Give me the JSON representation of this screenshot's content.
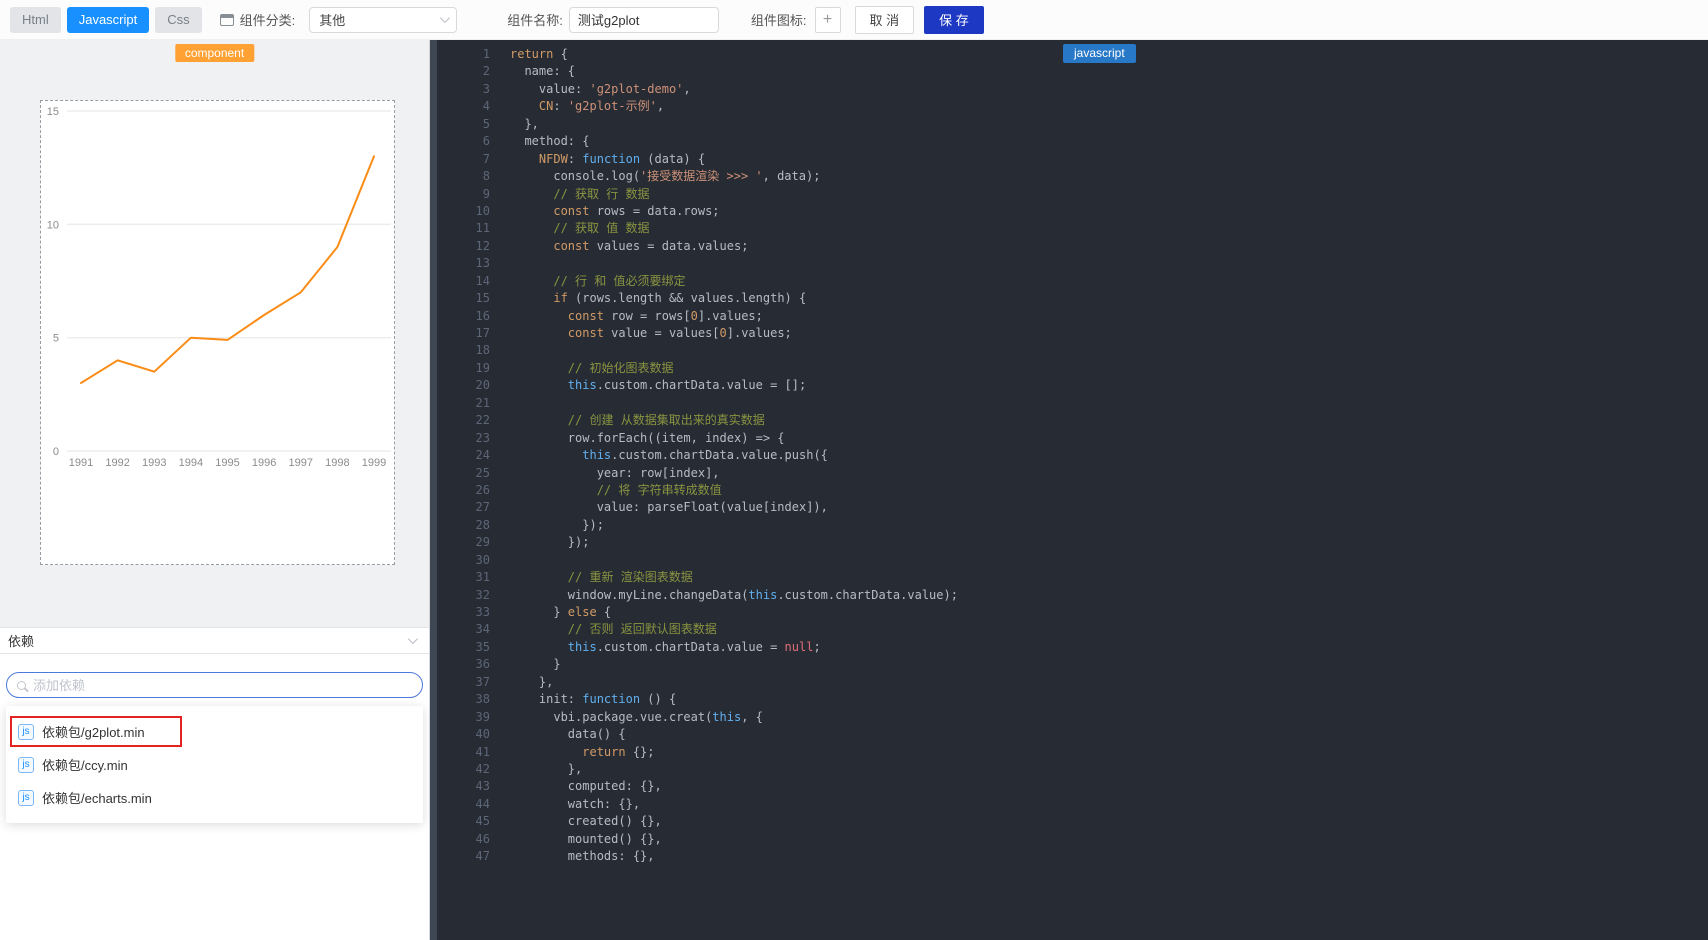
{
  "toolbar": {
    "tabs": [
      {
        "label": "Html"
      },
      {
        "label": "Javascript"
      },
      {
        "label": "Css"
      }
    ],
    "active_tab": "Javascript",
    "category_label": "组件分类:",
    "category_value": "其他",
    "name_label": "组件名称:",
    "name_value": "测试g2plot",
    "icon_label": "组件图标:",
    "add_icon_label": "+",
    "cancel_label": "取 消",
    "save_label": "保 存"
  },
  "left_panel": {
    "component_badge": "component",
    "deps_header": "依赖",
    "search_placeholder": "添加依赖",
    "deps": [
      {
        "icon": "js",
        "label": "依赖包/g2plot.min",
        "highlighted": true
      },
      {
        "icon": "js",
        "label": "依赖包/ccy.min",
        "highlighted": false
      },
      {
        "icon": "js",
        "label": "依赖包/echarts.min",
        "highlighted": false
      }
    ]
  },
  "chart_data": {
    "type": "line",
    "title": "",
    "x": [
      "1991",
      "1992",
      "1993",
      "1994",
      "1995",
      "1996",
      "1997",
      "1998",
      "1999"
    ],
    "values": [
      3,
      4,
      3.5,
      5,
      4.9,
      6,
      7,
      9,
      13
    ],
    "ylim": [
      0,
      15
    ],
    "yticks": [
      0,
      5,
      10,
      15
    ],
    "grid": "horizontal",
    "legend": "none",
    "line_color": "#FA8C16"
  },
  "editor": {
    "language_badge": "javascript",
    "lines": [
      [
        [
          "k",
          "return"
        ],
        [
          "p",
          " {"
        ]
      ],
      [
        [
          "p",
          "  name: {"
        ]
      ],
      [
        [
          "p",
          "    value: "
        ],
        [
          "s",
          "'g2plot-demo'"
        ],
        [
          "p",
          ","
        ]
      ],
      [
        [
          "p",
          "    "
        ],
        [
          "k",
          "CN"
        ],
        [
          "p",
          ": "
        ],
        [
          "s",
          "'g2plot-示例'"
        ],
        [
          "p",
          ","
        ]
      ],
      [
        [
          "p",
          "  },"
        ]
      ],
      [
        [
          "p",
          "  method: {"
        ]
      ],
      [
        [
          "p",
          "    "
        ],
        [
          "k",
          "NFDW"
        ],
        [
          "p",
          ": "
        ],
        [
          "b",
          "function"
        ],
        [
          "p",
          " (data) {"
        ]
      ],
      [
        [
          "p",
          "      console.log("
        ],
        [
          "s",
          "'接受数据渲染 >>> '"
        ],
        [
          "p",
          ", data);"
        ]
      ],
      [
        [
          "c",
          "      // 获取 行 数据"
        ]
      ],
      [
        [
          "p",
          "      "
        ],
        [
          "k",
          "const"
        ],
        [
          "p",
          " rows = data.rows;"
        ]
      ],
      [
        [
          "c",
          "      // 获取 值 数据"
        ]
      ],
      [
        [
          "p",
          "      "
        ],
        [
          "k",
          "const"
        ],
        [
          "p",
          " values = data.values;"
        ]
      ],
      [],
      [
        [
          "c",
          "      // 行 和 值必须要绑定"
        ]
      ],
      [
        [
          "p",
          "      "
        ],
        [
          "k",
          "if"
        ],
        [
          "p",
          " (rows.length && values.length) {"
        ]
      ],
      [
        [
          "p",
          "        "
        ],
        [
          "k",
          "const"
        ],
        [
          "p",
          " row = rows["
        ],
        [
          "k",
          "0"
        ],
        [
          "p",
          "].values;"
        ]
      ],
      [
        [
          "p",
          "        "
        ],
        [
          "k",
          "const"
        ],
        [
          "p",
          " value = values["
        ],
        [
          "k",
          "0"
        ],
        [
          "p",
          "].values;"
        ]
      ],
      [],
      [
        [
          "c",
          "        // 初始化图表数据"
        ]
      ],
      [
        [
          "p",
          "        "
        ],
        [
          "b",
          "this"
        ],
        [
          "p",
          ".custom.chartData.value = [];"
        ]
      ],
      [],
      [
        [
          "c",
          "        // 创建 从数据集取出来的真实数据"
        ]
      ],
      [
        [
          "p",
          "        row.forEach((item, index) => {"
        ]
      ],
      [
        [
          "p",
          "          "
        ],
        [
          "b",
          "this"
        ],
        [
          "p",
          ".custom.chartData.value.push({"
        ]
      ],
      [
        [
          "p",
          "            year: row[index],"
        ]
      ],
      [
        [
          "c",
          "            // 将 字符串转成数值"
        ]
      ],
      [
        [
          "p",
          "            value: parseFloat(value[index]),"
        ]
      ],
      [
        [
          "p",
          "          });"
        ]
      ],
      [
        [
          "p",
          "        });"
        ]
      ],
      [],
      [
        [
          "c",
          "        // 重新 渲染图表数据"
        ]
      ],
      [
        [
          "p",
          "        window.myLine.changeData("
        ],
        [
          "b",
          "this"
        ],
        [
          "p",
          ".custom.chartData.value);"
        ]
      ],
      [
        [
          "p",
          "      } "
        ],
        [
          "k",
          "else"
        ],
        [
          "p",
          " {"
        ]
      ],
      [
        [
          "c",
          "        // 否则 返回默认图表数据"
        ]
      ],
      [
        [
          "p",
          "        "
        ],
        [
          "b",
          "this"
        ],
        [
          "p",
          ".custom.chartData.value = "
        ],
        [
          "r",
          "null"
        ],
        [
          "p",
          ";"
        ]
      ],
      [
        [
          "p",
          "      }"
        ]
      ],
      [
        [
          "p",
          "    },"
        ]
      ],
      [
        [
          "p",
          "    init: "
        ],
        [
          "b",
          "function"
        ],
        [
          "p",
          " () {"
        ]
      ],
      [
        [
          "p",
          "      vbi.package.vue.creat("
        ],
        [
          "b",
          "this"
        ],
        [
          "p",
          ", {"
        ]
      ],
      [
        [
          "p",
          "        data() {"
        ]
      ],
      [
        [
          "p",
          "          "
        ],
        [
          "k",
          "return"
        ],
        [
          "p",
          " {};"
        ]
      ],
      [
        [
          "p",
          "        },"
        ]
      ],
      [
        [
          "p",
          "        computed: {},"
        ]
      ],
      [
        [
          "p",
          "        watch: {},"
        ]
      ],
      [
        [
          "p",
          "        created() {},"
        ]
      ],
      [
        [
          "p",
          "        mounted() {},"
        ]
      ],
      [
        [
          "p",
          "        methods: {},"
        ]
      ]
    ]
  },
  "colors": {
    "accent_blue": "#1890FF",
    "save_blue": "#1D39C4",
    "badge_orange": "#FFA133",
    "chart_line_orange": "#FA8C16",
    "highlight_red": "#E32222",
    "editor_badge_blue": "#2878C8"
  }
}
